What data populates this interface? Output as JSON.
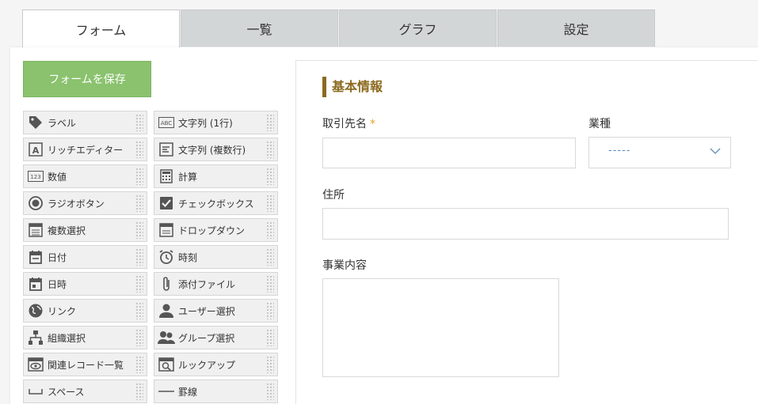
{
  "tabs": [
    "フォーム",
    "一覧",
    "グラフ",
    "設定"
  ],
  "save_button": "フォームを保存",
  "palette": [
    {
      "label": "ラベル",
      "icon": "tag-icon"
    },
    {
      "label": "文字列 (1行)",
      "icon": "abc-icon"
    },
    {
      "label": "リッチエディター",
      "icon": "rich-text-icon"
    },
    {
      "label": "文字列 (複数行)",
      "icon": "multiline-icon"
    },
    {
      "label": "数値",
      "icon": "number-icon"
    },
    {
      "label": "計算",
      "icon": "calculator-icon"
    },
    {
      "label": "ラジオボタン",
      "icon": "radio-icon"
    },
    {
      "label": "チェックボックス",
      "icon": "checkbox-icon"
    },
    {
      "label": "複数選択",
      "icon": "multi-select-icon"
    },
    {
      "label": "ドロップダウン",
      "icon": "dropdown-icon"
    },
    {
      "label": "日付",
      "icon": "date-icon"
    },
    {
      "label": "時刻",
      "icon": "clock-icon"
    },
    {
      "label": "日時",
      "icon": "datetime-icon"
    },
    {
      "label": "添付ファイル",
      "icon": "paperclip-icon"
    },
    {
      "label": "リンク",
      "icon": "globe-icon"
    },
    {
      "label": "ユーザー選択",
      "icon": "user-icon"
    },
    {
      "label": "組織選択",
      "icon": "org-icon"
    },
    {
      "label": "グループ選択",
      "icon": "group-icon"
    },
    {
      "label": "関連レコード一覧",
      "icon": "related-records-icon"
    },
    {
      "label": "ルックアップ",
      "icon": "lookup-icon"
    },
    {
      "label": "スペース",
      "icon": "space-icon"
    },
    {
      "label": "罫線",
      "icon": "line-icon"
    }
  ],
  "form": {
    "section_title": "基本情報",
    "company_label": "取引先名",
    "required_mark": "*",
    "industry_label": "業種",
    "industry_value": "-----",
    "address_label": "住所",
    "business_label": "事業内容"
  }
}
